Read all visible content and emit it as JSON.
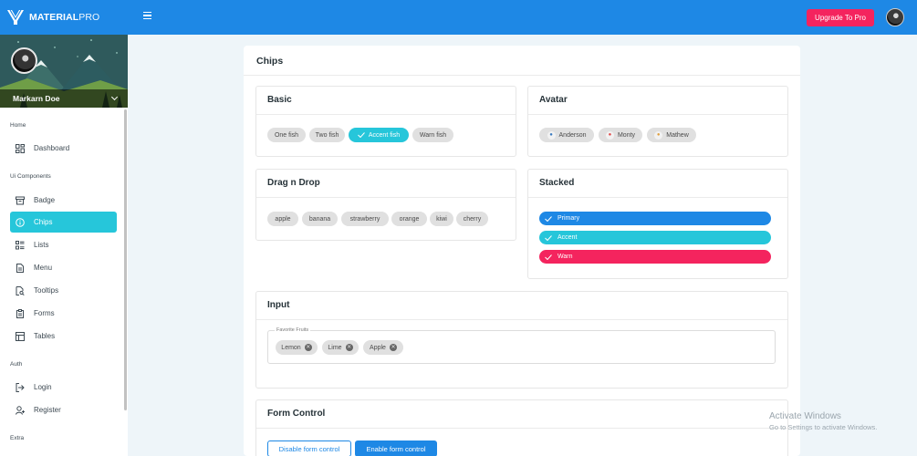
{
  "brand": {
    "name_bold": "MATERIAL",
    "name_thin": "PRO"
  },
  "topbar": {
    "upgrade_label": "Upgrade To Pro",
    "menu_icon": "hamburger-icon"
  },
  "colors": {
    "primary": "#1e88e5",
    "accent": "#26c6da",
    "warn": "#f4245e"
  },
  "sidebar": {
    "user_name": "Markarn Doe",
    "sections": [
      {
        "label": "Home",
        "items": [
          {
            "label": "Dashboard",
            "icon": "dashboard-icon"
          }
        ]
      },
      {
        "label": "Ui Components",
        "items": [
          {
            "label": "Badge",
            "icon": "archive-icon"
          },
          {
            "label": "Chips",
            "icon": "info-icon",
            "active": true
          },
          {
            "label": "Lists",
            "icon": "list-icon"
          },
          {
            "label": "Menu",
            "icon": "file-icon"
          },
          {
            "label": "Tooltips",
            "icon": "file-search-icon"
          },
          {
            "label": "Forms",
            "icon": "clipboard-icon"
          },
          {
            "label": "Tables",
            "icon": "table-icon"
          }
        ]
      },
      {
        "label": "Auth",
        "items": [
          {
            "label": "Login",
            "icon": "login-icon"
          },
          {
            "label": "Register",
            "icon": "user-plus-icon"
          }
        ]
      },
      {
        "label": "Extra",
        "items": []
      }
    ]
  },
  "page": {
    "title": "Chips",
    "basic": {
      "title": "Basic",
      "chips": [
        "One fish",
        "Two fish",
        "Accent fish",
        "Warn fish"
      ]
    },
    "avatar": {
      "title": "Avatar",
      "chips": [
        "Anderson",
        "Monty",
        "Mathew"
      ]
    },
    "drag": {
      "title": "Drag n Drop",
      "chips": [
        "apple",
        "banana",
        "strawberry",
        "orange",
        "kiwi",
        "cherry"
      ]
    },
    "stacked": {
      "title": "Stacked",
      "chips": [
        "Primary",
        "Accent",
        "Warn"
      ]
    },
    "input": {
      "title": "Input",
      "field_label": "Favorite Fruits",
      "chips": [
        "Lemon",
        "Lime",
        "Apple"
      ]
    },
    "form_control": {
      "title": "Form Control",
      "disable_label": "Disable form control",
      "enable_label": "Enable form control"
    }
  },
  "watermark": {
    "line1": "Activate Windows",
    "line2": "Go to Settings to activate Windows."
  }
}
